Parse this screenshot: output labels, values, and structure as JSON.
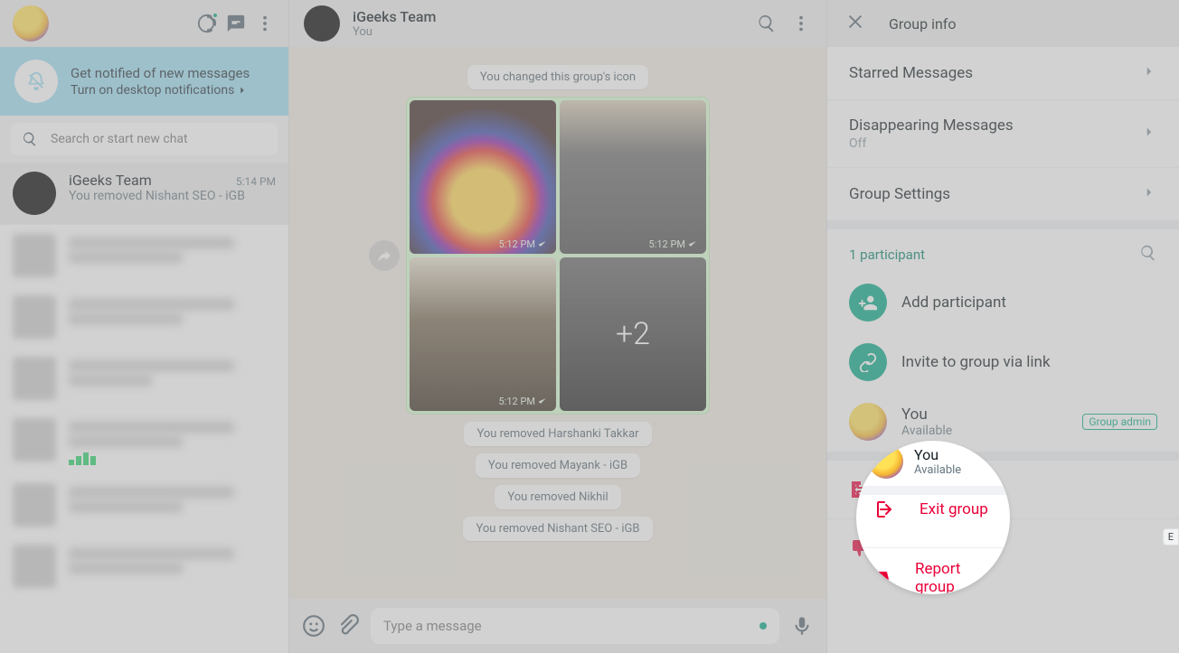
{
  "sidebar": {
    "notif_title": "Get notified of new messages",
    "notif_link": "Turn on desktop notifications",
    "search_placeholder": "Search or start new chat",
    "chat": {
      "name": "iGeeks Team",
      "time": "5:14 PM",
      "preview": "You removed Nishant SEO - iGB"
    }
  },
  "chat": {
    "title": "iGeeks Team",
    "subtitle": "You",
    "sys_messages": [
      "You changed this group's icon",
      "You removed Harshanki Takkar",
      "You removed Mayank - iGB",
      "You removed Nikhil",
      "You removed Nishant SEO - iGB"
    ],
    "media_time": "5:12 PM",
    "media_more": "+2",
    "compose_placeholder": "Type a message"
  },
  "panel": {
    "title": "Group info",
    "starred": "Starred Messages",
    "disappearing": "Disappearing Messages",
    "disappearing_state": "Off",
    "settings": "Group Settings",
    "participants": "1 participant",
    "add": "Add participant",
    "invite": "Invite to group via link",
    "you": "You",
    "you_status": "Available",
    "admin": "Group admin",
    "exit": "Exit group",
    "report": "Report group"
  },
  "edge_tag": "E"
}
